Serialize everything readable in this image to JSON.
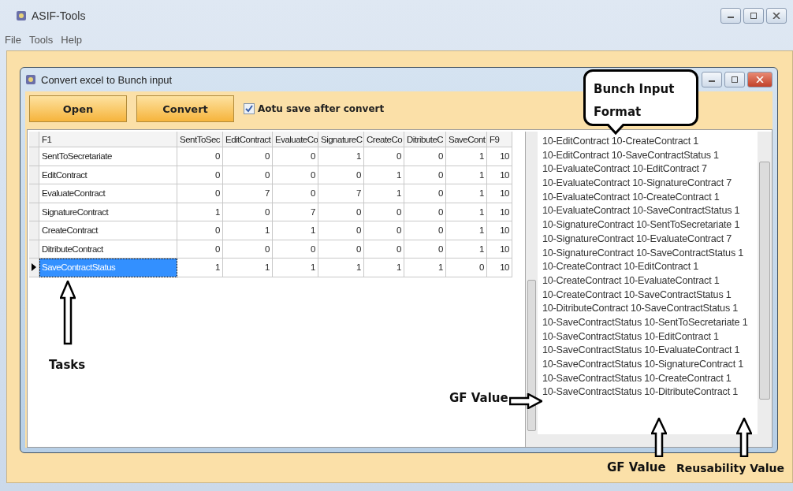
{
  "window": {
    "title": "ASIF-Tools"
  },
  "menu": [
    {
      "label": "File"
    },
    {
      "label": "Tools"
    },
    {
      "label": "Help"
    }
  ],
  "dialog": {
    "title": "Convert excel to Bunch input"
  },
  "toolbar": {
    "buttons": [
      {
        "label": "Open"
      },
      {
        "label": "Convert"
      }
    ],
    "checkbox": {
      "label": "Aotu save after convert",
      "checked": true
    }
  },
  "table": {
    "columns": [
      "F1",
      "SentToSec",
      "EditContract",
      "EvaluateCo",
      "SignatureC",
      "CreateCo",
      "DitributeC",
      "SaveCont",
      "F9"
    ],
    "rows": [
      {
        "cells": [
          "SentToSecretariate",
          "0",
          "0",
          "0",
          "1",
          "0",
          "0",
          "1",
          "10"
        ],
        "selected": false
      },
      {
        "cells": [
          "EditContract",
          "0",
          "0",
          "0",
          "0",
          "1",
          "0",
          "1",
          "10"
        ],
        "selected": false
      },
      {
        "cells": [
          "EvaluateContract",
          "0",
          "7",
          "0",
          "7",
          "1",
          "0",
          "1",
          "10"
        ],
        "selected": false
      },
      {
        "cells": [
          "SignatureContract",
          "1",
          "0",
          "7",
          "0",
          "0",
          "0",
          "1",
          "10"
        ],
        "selected": false
      },
      {
        "cells": [
          "CreateContract",
          "0",
          "1",
          "1",
          "0",
          "0",
          "0",
          "1",
          "10"
        ],
        "selected": false
      },
      {
        "cells": [
          "DitributeContract",
          "0",
          "0",
          "0",
          "0",
          "0",
          "0",
          "1",
          "10"
        ],
        "selected": false
      },
      {
        "cells": [
          "SaveContractStatus",
          "1",
          "1",
          "1",
          "1",
          "1",
          "1",
          "0",
          "10"
        ],
        "selected": true
      }
    ]
  },
  "output_lines": [
    "10-EditContract 10-CreateContract 1",
    "10-EditContract 10-SaveContractStatus 1",
    "10-EvaluateContract 10-EditContract 7",
    "10-EvaluateContract 10-SignatureContract 7",
    "10-EvaluateContract 10-CreateContract 1",
    "10-EvaluateContract 10-SaveContractStatus 1",
    "10-SignatureContract 10-SentToSecretariate 1",
    "10-SignatureContract 10-EvaluateContract 7",
    "10-SignatureContract 10-SaveContractStatus 1",
    "10-CreateContract 10-EditContract 1",
    "10-CreateContract 10-EvaluateContract 1",
    "10-CreateContract 10-SaveContractStatus 1",
    "10-DitributeContract 10-SaveContractStatus 1",
    "10-SaveContractStatus 10-SentToSecretariate 1",
    "10-SaveContractStatus 10-EditContract 1",
    "10-SaveContractStatus 10-EvaluateContract 1",
    "10-SaveContractStatus 10-SignatureContract 1",
    "10-SaveContractStatus 10-CreateContract 1",
    "10-SaveContractStatus 10-DitributeContract 1"
  ],
  "annotations": [
    {
      "kind": "callout",
      "text": "Bunch Input Format"
    },
    {
      "kind": "label",
      "text": "Tasks"
    },
    {
      "kind": "label",
      "text": "GF Value"
    },
    {
      "kind": "label",
      "text": "GF Value"
    },
    {
      "kind": "label",
      "text": "Reusability Value"
    }
  ]
}
